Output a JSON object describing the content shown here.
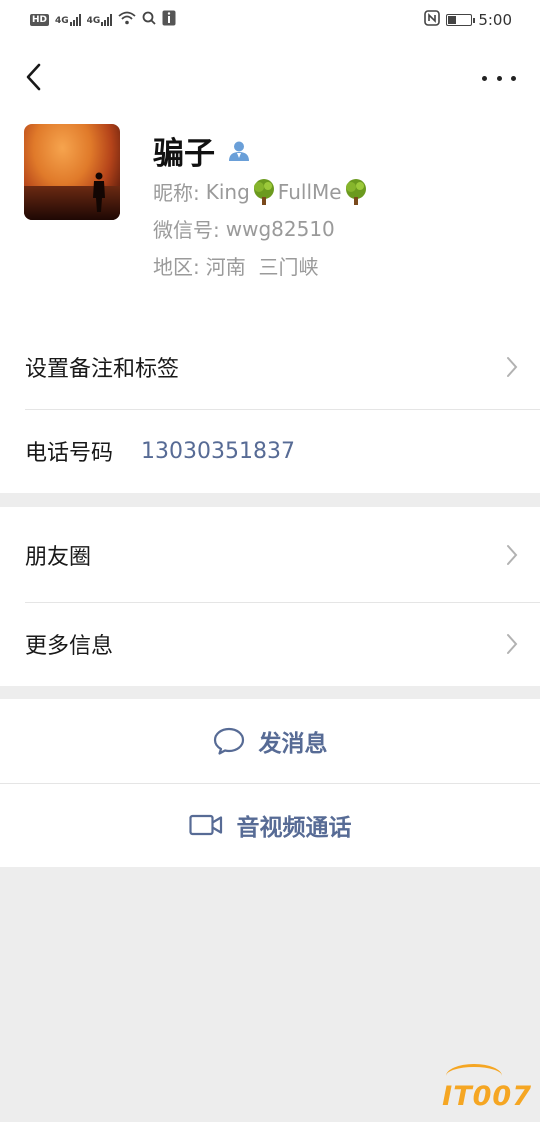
{
  "status_bar": {
    "hd": "HD",
    "signal1": "4G",
    "signal2": "4G",
    "time": "5:00",
    "battery_level": 0.35,
    "icons": [
      "hd-badge",
      "cell-signal",
      "cell-signal",
      "wifi-icon",
      "search-icon",
      "info-icon",
      "nfc-icon",
      "battery-icon"
    ]
  },
  "header": {
    "back_icon": "chevron-left-icon",
    "more_icon": "more-dots-icon"
  },
  "profile": {
    "name": "骗子",
    "nickname_label": "昵称:",
    "nickname_part1": "King",
    "nickname_part2": " FullMe",
    "nickname_emoji": "tree-emoji",
    "wechat_id_label": "微信号:",
    "wechat_id": "wwg82510",
    "region_label": "地区:",
    "region": "河南  三门峡"
  },
  "section1": {
    "remark_label": "设置备注和标签",
    "phone_label": "电话号码",
    "phone_value": "13030351837"
  },
  "section2": {
    "moments_label": "朋友圈",
    "more_info_label": "更多信息"
  },
  "actions": {
    "message_label": "发消息",
    "call_label": "音视频通话"
  },
  "watermark": "IT007",
  "colors": {
    "link_blue": "#576b95",
    "background": "#ededed",
    "watermark": "#f5a623"
  }
}
